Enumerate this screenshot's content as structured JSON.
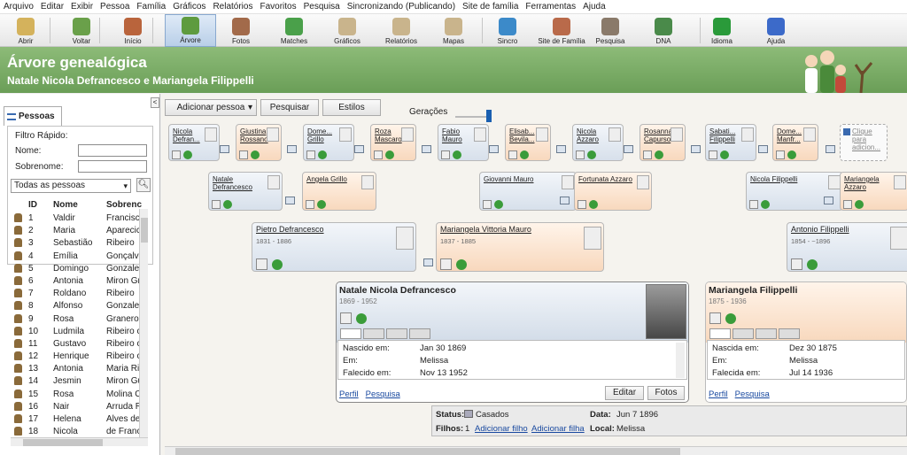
{
  "menu": [
    "Arquivo",
    "Editar",
    "Exibir",
    "Pessoa",
    "Família",
    "Gráficos",
    "Relatórios",
    "Favoritos",
    "Pesquisa",
    "Sincronizando (Publicando)",
    "Site de família",
    "Ferramentas",
    "Ajuda"
  ],
  "toolbar": [
    {
      "label": "Abrir",
      "icon": "folder-icon",
      "color": "#d4b25c"
    },
    {
      "label": "Voltar",
      "icon": "back-arrow-icon",
      "color": "#6aa04a"
    },
    {
      "label": "Início",
      "icon": "home-icon",
      "color": "#b9643c"
    },
    {
      "label": "Árvore",
      "icon": "tree-icon",
      "color": "#5e9b3f"
    },
    {
      "label": "Fotos",
      "icon": "photos-icon",
      "color": "#a26a4a"
    },
    {
      "label": "Matches",
      "icon": "matches-icon",
      "color": "#4aa04a"
    },
    {
      "label": "Gráficos",
      "icon": "charts-icon",
      "color": "#c9b48c"
    },
    {
      "label": "Relatórios",
      "icon": "reports-icon",
      "color": "#c9b48c"
    },
    {
      "label": "Mapas",
      "icon": "maps-icon",
      "color": "#c9b48c"
    },
    {
      "label": "Sincro",
      "icon": "sync-icon",
      "color": "#3c8ac9"
    },
    {
      "label": "Site de Família",
      "icon": "family-site-icon",
      "color": "#b96a4a"
    },
    {
      "label": "Pesquisa",
      "icon": "search-icon",
      "color": "#8a7a6a"
    },
    {
      "label": "DNA",
      "icon": "dna-icon",
      "color": "#4a8a4a"
    },
    {
      "label": "Idioma",
      "icon": "brazil-flag-icon",
      "color": "#2a9a3a"
    },
    {
      "label": "Ajuda",
      "icon": "help-icon",
      "color": "#3c6ac9"
    }
  ],
  "banner": {
    "title": "Árvore genealógica",
    "subtitle": "Natale Nicola Defrancesco e Mariangela Filippelli"
  },
  "sidebar": {
    "tab": "Pessoas",
    "filter_title": "Filtro Rápido:",
    "name_label": "Nome:",
    "surname_label": "Sobrenome:",
    "dropdown": "Todas as pessoas",
    "columns": [
      "ID",
      "Nome",
      "Sobrenc"
    ],
    "rows": [
      [
        "1",
        "Valdir",
        "Francisc"
      ],
      [
        "2",
        "Maria",
        "Aparecic"
      ],
      [
        "3",
        "Sebastião",
        "Ribeiro"
      ],
      [
        "4",
        "Emília",
        "Gonçalv"
      ],
      [
        "5",
        "Domingo",
        "Gonzale"
      ],
      [
        "6",
        "Antonia",
        "Miron Gr"
      ],
      [
        "7",
        "Roldano",
        "Ribeiro"
      ],
      [
        "8",
        "Alfonso",
        "Gonzale"
      ],
      [
        "9",
        "Rosa",
        "Granero"
      ],
      [
        "10",
        "Ludmila",
        "Ribeiro c"
      ],
      [
        "11",
        "Gustavo",
        "Ribeiro c"
      ],
      [
        "12",
        "Henrique",
        "Ribeiro c"
      ],
      [
        "13",
        "Antonia",
        "Maria Ri"
      ],
      [
        "14",
        "Jesmin",
        "Miron Gu"
      ],
      [
        "15",
        "Rosa",
        "Molina C"
      ],
      [
        "16",
        "Nair",
        "Arruda R"
      ],
      [
        "17",
        "Helena",
        "Alves de"
      ],
      [
        "18",
        "Nicola",
        "de Franc"
      ]
    ]
  },
  "tree_toolbar": {
    "add_person": "Adicionar pessoa",
    "search": "Pesquisar",
    "styles": "Estilos",
    "generations": "Gerações"
  },
  "gg": [
    {
      "name": "Nicola Defran...",
      "sex": "m"
    },
    {
      "name": "Giustina Rossano",
      "sex": "f"
    },
    {
      "name": "Dome... Grillo",
      "sex": "m"
    },
    {
      "name": "Roza Mascaro",
      "sex": "f"
    },
    {
      "name": "Fabio Mauro",
      "sex": "m"
    },
    {
      "name": "Elisab... Bevila...",
      "sex": "f"
    },
    {
      "name": "Nicola Azzaro",
      "sex": "m"
    },
    {
      "name": "Rosanna Capurso",
      "sex": "f"
    },
    {
      "name": "Sabati... Filippelli",
      "sex": "m"
    },
    {
      "name": "Dome... Manfr...",
      "sex": "f"
    },
    {
      "name": "Clique para adicion...",
      "sex": "add"
    }
  ],
  "g": [
    {
      "name": "Natale Defrancesco",
      "sex": "m"
    },
    {
      "name": "Angela Grillo",
      "sex": "f"
    },
    {
      "name": "Giovanni Mauro",
      "sex": "m"
    },
    {
      "name": "Fortunata Azzaro",
      "sex": "f"
    },
    {
      "name": "Nicola Filippelli",
      "sex": "m"
    },
    {
      "name": "Mariangela Azzaro",
      "sex": "f"
    }
  ],
  "p": [
    {
      "name": "Pietro Defrancesco",
      "dates": "1831 - 1886",
      "sex": "m"
    },
    {
      "name": "Mariangela Vittoria Mauro",
      "dates": "1837 - 1885",
      "sex": "f"
    },
    {
      "name": "Antonio Filippelli",
      "dates": "1854 - ~1896",
      "sex": "m"
    }
  ],
  "main_person": {
    "name": "Natale Nicola Defrancesco",
    "dates": "1869 - 1952",
    "rows": [
      [
        "Nascido em:",
        "Jan 30 1869"
      ],
      [
        "Em:",
        "Melissa"
      ],
      [
        "Falecido em:",
        "Nov 13 1952"
      ]
    ],
    "profile": "Perfil",
    "search": "Pesquisa",
    "edit": "Editar",
    "photos": "Fotos"
  },
  "spouse": {
    "name": "Mariangela Filippelli",
    "dates": "1875 - 1936",
    "rows": [
      [
        "Nascida em:",
        "Dez 30 1875"
      ],
      [
        "Em:",
        "Melissa"
      ],
      [
        "Falecida em:",
        "Jul 14 1936"
      ]
    ],
    "profile": "Perfil",
    "search": "Pesquisa"
  },
  "status": {
    "status_label": "Status:",
    "status_value": "Casados",
    "date_label": "Data:",
    "date_value": "Jun 7 1896",
    "children_label": "Filhos:",
    "children_value": "1",
    "add_son": "Adicionar filho",
    "add_daughter": "Adicionar filha",
    "place_label": "Local:",
    "place_value": "Melissa"
  }
}
